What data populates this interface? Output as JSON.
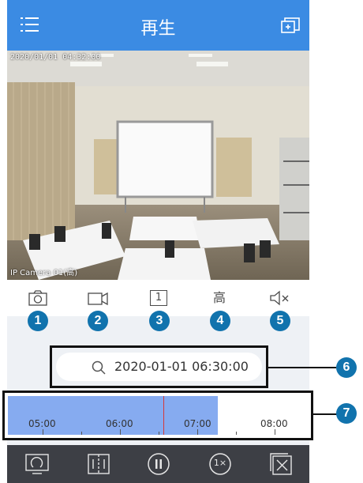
{
  "header": {
    "title": "再生",
    "menu_icon": "menu-icon",
    "screen_icon": "screen-add-icon"
  },
  "video": {
    "timestamp": "2020/01/01 04:32:00",
    "camera_name": "IP Camera 01(高)"
  },
  "toolbar": {
    "snapshot": "camera-icon",
    "record": "video-record-icon",
    "channel": "1",
    "quality": "高",
    "audio": "mute-icon"
  },
  "callouts": [
    "1",
    "2",
    "3",
    "4",
    "5",
    "6",
    "7"
  ],
  "search": {
    "date": "2020-01-01 06:30:00",
    "icon": "search-icon"
  },
  "timeline": {
    "labels": [
      "05:00",
      "06:00",
      "07:00",
      "08:00"
    ],
    "recorded_until": "07:20",
    "cursor_time": "06:30"
  },
  "playbar": {
    "speed": "1×",
    "icons": [
      "fullscreen-icon",
      "split-view-icon",
      "pause-icon",
      "speed-icon",
      "close-icon"
    ]
  },
  "colors": {
    "header": "#3b8be3",
    "badge": "#1173ad",
    "timeline_fill": "#86abf0",
    "cursor": "#d43a3a",
    "playbar": "#3d3f45"
  }
}
